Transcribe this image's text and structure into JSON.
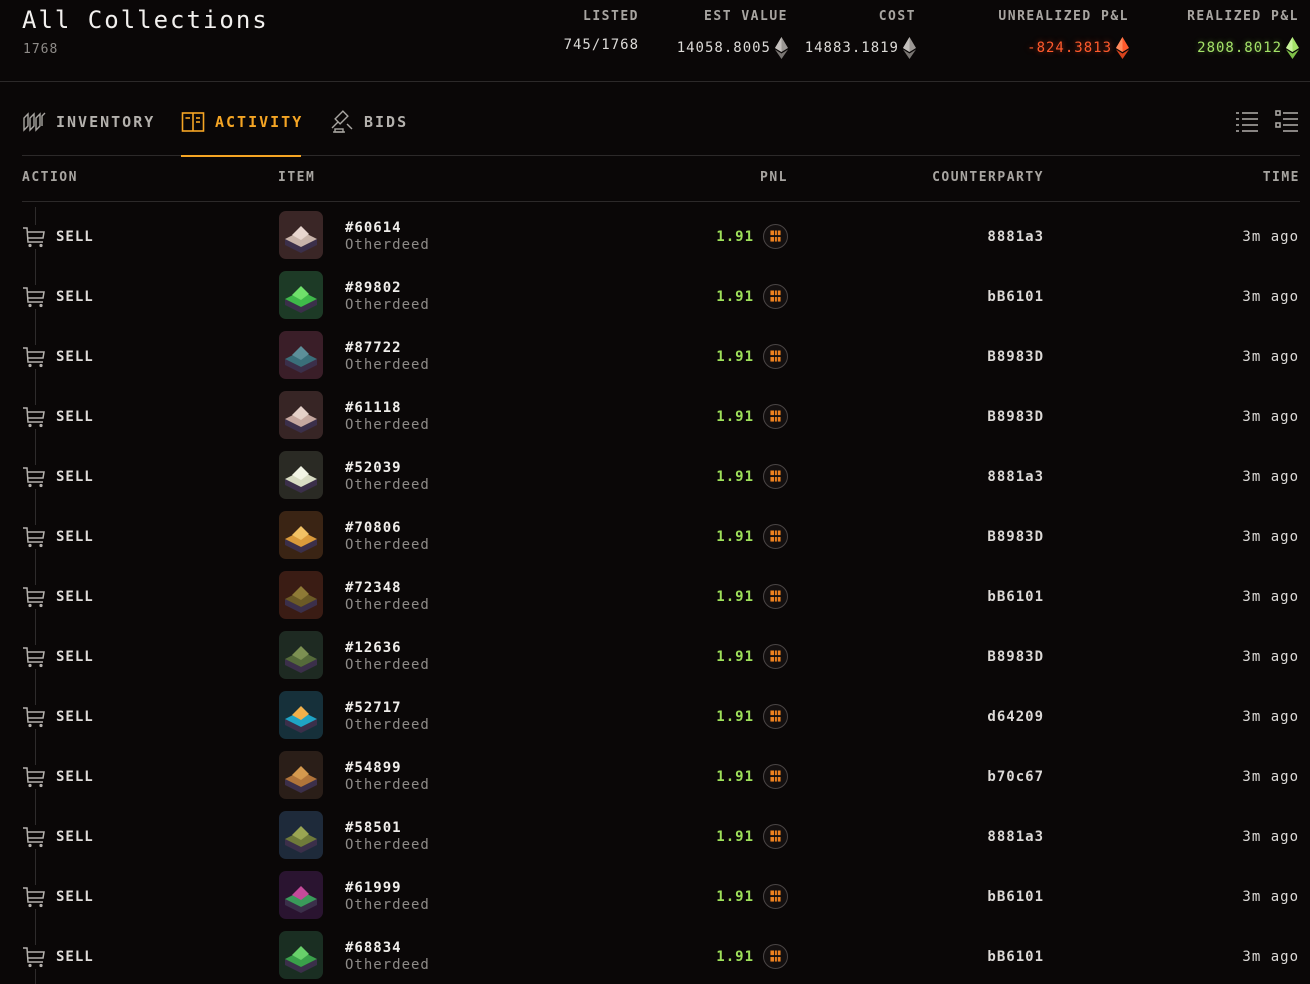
{
  "header": {
    "title": "All Collections",
    "count": "1768",
    "stats": {
      "listed": {
        "label": "LISTED",
        "value": "745/1768"
      },
      "est_value": {
        "label": "EST VALUE",
        "value": "14058.8005",
        "icon": "eth-icon"
      },
      "cost": {
        "label": "COST",
        "value": "14883.1819",
        "icon": "eth-icon"
      },
      "unrealized": {
        "label": "UNREALIZED P&L",
        "value": "-824.3813",
        "icon": "eth-icon",
        "color": "#ff5a2c"
      },
      "realized": {
        "label": "REALIZED P&L",
        "value": "2808.8012",
        "icon": "eth-icon",
        "color": "#a4e268"
      }
    }
  },
  "tabs": [
    {
      "label": "INVENTORY",
      "icon": "inventory-icon",
      "active": false
    },
    {
      "label": "ACTIVITY",
      "icon": "activity-book-icon",
      "active": true
    },
    {
      "label": "BIDS",
      "icon": "gavel-icon",
      "active": false
    }
  ],
  "view_buttons": [
    "list-view-icon",
    "detailed-list-view-icon"
  ],
  "table": {
    "columns": {
      "action": "ACTION",
      "item": "ITEM",
      "pnl": "PNL",
      "counterparty": "COUNTERPARTY",
      "time": "TIME"
    },
    "rows": [
      {
        "action": "SELL",
        "id": "#60614",
        "collection": "Otherdeed",
        "pnl": "1.91",
        "counterparty": "8881a3",
        "time": "3m ago",
        "thumb_colors": [
          "#c9b4aa",
          "#e8d6cf",
          "#3a2626"
        ]
      },
      {
        "action": "SELL",
        "id": "#89802",
        "collection": "Otherdeed",
        "pnl": "1.91",
        "counterparty": "bB6101",
        "time": "3m ago",
        "thumb_colors": [
          "#3fb84a",
          "#6fe06a",
          "#1d3a26"
        ]
      },
      {
        "action": "SELL",
        "id": "#87722",
        "collection": "Otherdeed",
        "pnl": "1.91",
        "counterparty": "B8983D",
        "time": "3m ago",
        "thumb_colors": [
          "#3a6f7a",
          "#5c8f99",
          "#3a1e28"
        ]
      },
      {
        "action": "SELL",
        "id": "#61118",
        "collection": "Otherdeed",
        "pnl": "1.91",
        "counterparty": "B8983D",
        "time": "3m ago",
        "thumb_colors": [
          "#c5a79f",
          "#e5d1c9",
          "#372525"
        ]
      },
      {
        "action": "SELL",
        "id": "#52039",
        "collection": "Otherdeed",
        "pnl": "1.91",
        "counterparty": "8881a3",
        "time": "3m ago",
        "thumb_colors": [
          "#d8dcc4",
          "#f3f5e6",
          "#2a2a24"
        ]
      },
      {
        "action": "SELL",
        "id": "#70806",
        "collection": "Otherdeed",
        "pnl": "1.91",
        "counterparty": "B8983D",
        "time": "3m ago",
        "thumb_colors": [
          "#d99a3b",
          "#f2c264",
          "#3a2414"
        ]
      },
      {
        "action": "SELL",
        "id": "#72348",
        "collection": "Otherdeed",
        "pnl": "1.91",
        "counterparty": "bB6101",
        "time": "3m ago",
        "thumb_colors": [
          "#6b5a26",
          "#8e7a36",
          "#3a1c14"
        ]
      },
      {
        "action": "SELL",
        "id": "#12636",
        "collection": "Otherdeed",
        "pnl": "1.91",
        "counterparty": "B8983D",
        "time": "3m ago",
        "thumb_colors": [
          "#556a3a",
          "#7c9052",
          "#1e2a22"
        ]
      },
      {
        "action": "SELL",
        "id": "#52717",
        "collection": "Otherdeed",
        "pnl": "1.91",
        "counterparty": "d64209",
        "time": "3m ago",
        "thumb_colors": [
          "#1fa3c4",
          "#f2b04a",
          "#16303a"
        ]
      },
      {
        "action": "SELL",
        "id": "#54899",
        "collection": "Otherdeed",
        "pnl": "1.91",
        "counterparty": "b70c67",
        "time": "3m ago",
        "thumb_colors": [
          "#b0743a",
          "#d4994e",
          "#2a1e18"
        ]
      },
      {
        "action": "SELL",
        "id": "#58501",
        "collection": "Otherdeed",
        "pnl": "1.91",
        "counterparty": "8881a3",
        "time": "3m ago",
        "thumb_colors": [
          "#6f7a3a",
          "#9aa552",
          "#1e2a3a"
        ]
      },
      {
        "action": "SELL",
        "id": "#61999",
        "collection": "Otherdeed",
        "pnl": "1.91",
        "counterparty": "bB6101",
        "time": "3m ago",
        "thumb_colors": [
          "#3a9a5a",
          "#c44a9a",
          "#2a1430"
        ]
      },
      {
        "action": "SELL",
        "id": "#68834",
        "collection": "Otherdeed",
        "pnl": "1.91",
        "counterparty": "bB6101",
        "time": "3m ago",
        "thumb_colors": [
          "#3aa04a",
          "#68d06a",
          "#1a2e22"
        ]
      }
    ]
  },
  "accent_color": "#f5a524",
  "pnl_color": "#9ee05a"
}
